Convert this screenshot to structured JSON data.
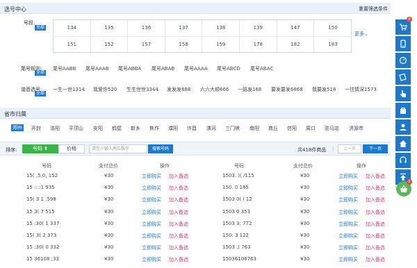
{
  "header": {
    "title": "选号中心",
    "reset_label": "重置筛选条件"
  },
  "number_filter": {
    "label": "号段:",
    "badge": "全部",
    "row1": [
      "134",
      "135",
      "136",
      "137",
      "138",
      "139",
      "147",
      "150"
    ],
    "row2": [
      "151",
      "152",
      "157",
      "158",
      "159",
      "178",
      "182",
      "183"
    ],
    "more_label": "更多⌄"
  },
  "tail_rule": {
    "label": "尾号规则:",
    "badge": "全部",
    "items": [
      "尾号AABB",
      "尾号AAAB",
      "尾号ABBA",
      "尾号ABAB",
      "尾号AAAA",
      "尾号ABCD",
      "尾号ABAC"
    ]
  },
  "theme": {
    "label": "谐音选号:",
    "badge": "全部",
    "items": [
      "一生一世1314",
      "我爱你520",
      "生生世世3344",
      "发发发888",
      "六六大顺666",
      "一路发168",
      "要发要发6868",
      "我要发518",
      "一往情深1573"
    ]
  },
  "region": {
    "title": "省市归属",
    "cities": [
      "郑州",
      "开封",
      "洛阳",
      "平顶山",
      "安阳",
      "鹤壁",
      "新乡",
      "焦作",
      "濮阳",
      "许昌",
      "漯河",
      "三门峡",
      "南阳",
      "商丘",
      "信阳",
      "周口",
      "驻马店",
      "济源市"
    ],
    "active_city": "郑州"
  },
  "sortbar": {
    "label": "排序:",
    "sort_number": "号码 ⬆",
    "sort_price": "价格",
    "search_placeholder": "请至少输入两位数字",
    "search_button": "搜索号码",
    "total": "共418件商品",
    "pipe": "|",
    "prev": "上一页",
    "next": "下一页"
  },
  "table": {
    "col_number": "号码",
    "col_price": "支付总价",
    "col_action": "操作",
    "buy_label": "立即购买",
    "add_label": "加入备选",
    "left_rows": [
      {
        "number": "15(  ,5,0, 152",
        "price": "¥30"
      },
      {
        "number": "15 ::::1  935",
        "price": "¥30"
      },
      {
        "number": "15( 3 1  .598",
        "price": "¥30"
      },
      {
        "number": "15 3( 7  515",
        "price": "¥30"
      },
      {
        "number": "15 :30( 1 337",
        "price": "¥30"
      },
      {
        "number": "15( 3( 2 373",
        "price": "¥30"
      },
      {
        "number": "15 :30( 0 332",
        "price": "¥30"
      },
      {
        "number": "15 36108 ;33",
        "price": "¥30"
      }
    ],
    "right_rows": [
      {
        "number": "1503. )( /115",
        "price": "¥30"
      },
      {
        "number": "150.  0  185",
        "price": "¥30"
      },
      {
        "number": "1503 0( I 12",
        "price": "¥30"
      },
      {
        "number": "1503 0  353",
        "price": "¥30"
      },
      {
        "number": "1503 3:  772",
        "price": "¥30"
      },
      {
        "number": "150:  3  122",
        "price": "¥30"
      },
      {
        "number": "1503 ,(  763",
        "price": "¥30"
      },
      {
        "number": "15036108763",
        "price": "¥30"
      }
    ]
  },
  "sidebar": {
    "cart_count_top": "0",
    "cart_count_bottom": "5"
  },
  "colors": {
    "accent": "#1f79c9",
    "green": "#3cb34a",
    "pink": "#e2456b"
  }
}
